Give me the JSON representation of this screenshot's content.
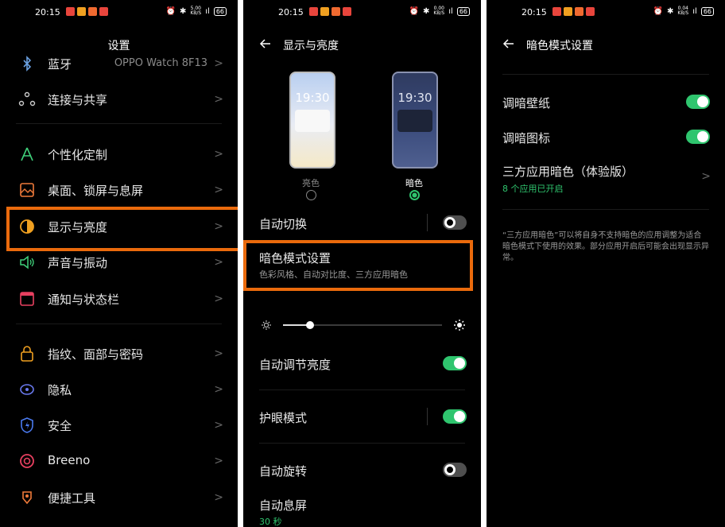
{
  "status": {
    "time": "20:15",
    "speed_top": "5.00",
    "speed_bottom": "KB/S",
    "signal": "⁵ᴳıl",
    "battery": "66",
    "speed2_top": "0.00",
    "speed3_top": "0.04"
  },
  "settings": {
    "title": "设置",
    "items": [
      {
        "label": "蓝牙",
        "value": "OPPO Watch 8F13"
      },
      {
        "label": "连接与共享"
      },
      {
        "label": "个性化定制"
      },
      {
        "label": "桌面、锁屏与息屏"
      },
      {
        "label": "显示与亮度"
      },
      {
        "label": "声音与振动"
      },
      {
        "label": "通知与状态栏"
      },
      {
        "label": "指纹、面部与密码"
      },
      {
        "label": "隐私"
      },
      {
        "label": "安全"
      },
      {
        "label": "Breeno"
      },
      {
        "label": "便捷工具"
      }
    ],
    "colors": {
      "accent": "#ea6a0c"
    }
  },
  "display": {
    "title": "显示与亮度",
    "preview_clock": "19:30",
    "light_label": "亮色",
    "dark_label": "暗色",
    "auto_switch": "自动切换",
    "dark_settings_title": "暗色模式设置",
    "dark_settings_sub": "色彩风格、自动对比度、三方应用暗色",
    "auto_brightness": "自动调节亮度",
    "eye_care": "护眼模式",
    "auto_rotate": "自动旋转",
    "screen_timeout": "自动息屏",
    "screen_timeout_value": "30 秒",
    "brightness_level": 0.17
  },
  "dark": {
    "title": "暗色模式设置",
    "dim_wallpaper": "调暗壁纸",
    "dim_icons": "调暗图标",
    "third_party": "三方应用暗色（体验版）",
    "third_party_sub": "8 个应用已开启",
    "note": "“三方应用暗色”可以将自身不支持暗色的应用调整为适合暗色模式下使用的效果。部分应用开启后可能会出现显示异常。"
  }
}
